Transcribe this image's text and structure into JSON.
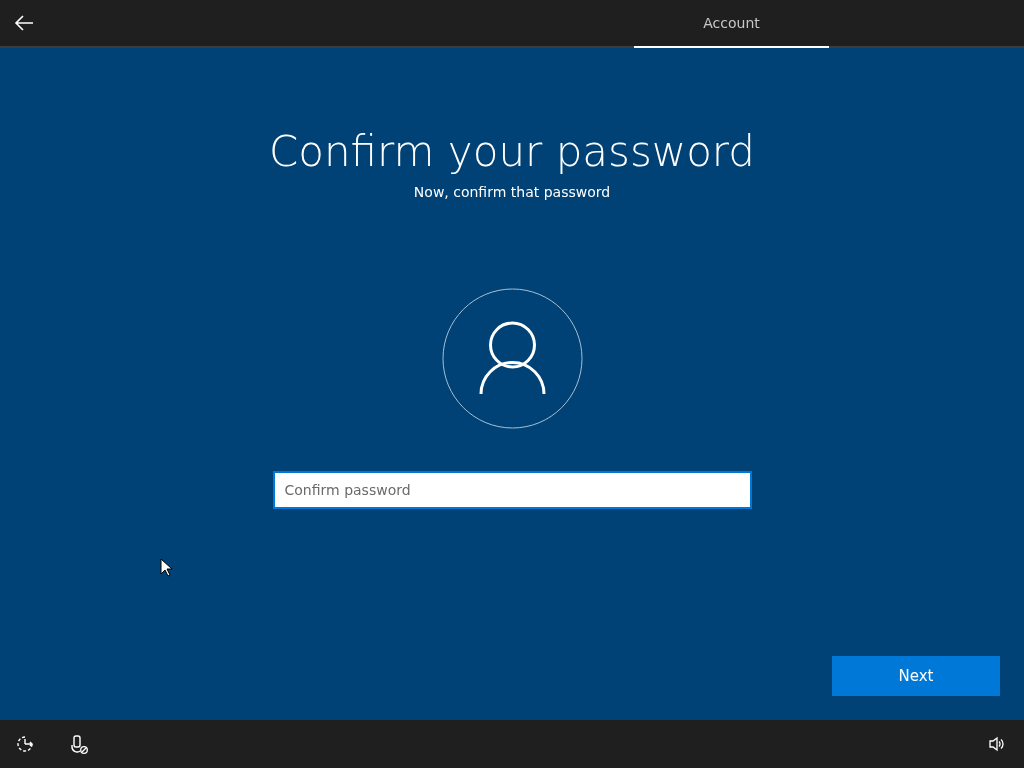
{
  "tabs": [
    {
      "label": "Account",
      "selected": true
    }
  ],
  "title": "Confirm your password",
  "subtitle": "Now, confirm that password",
  "password_field": {
    "placeholder": "Confirm password"
  },
  "next_button": {
    "label": "Next"
  }
}
